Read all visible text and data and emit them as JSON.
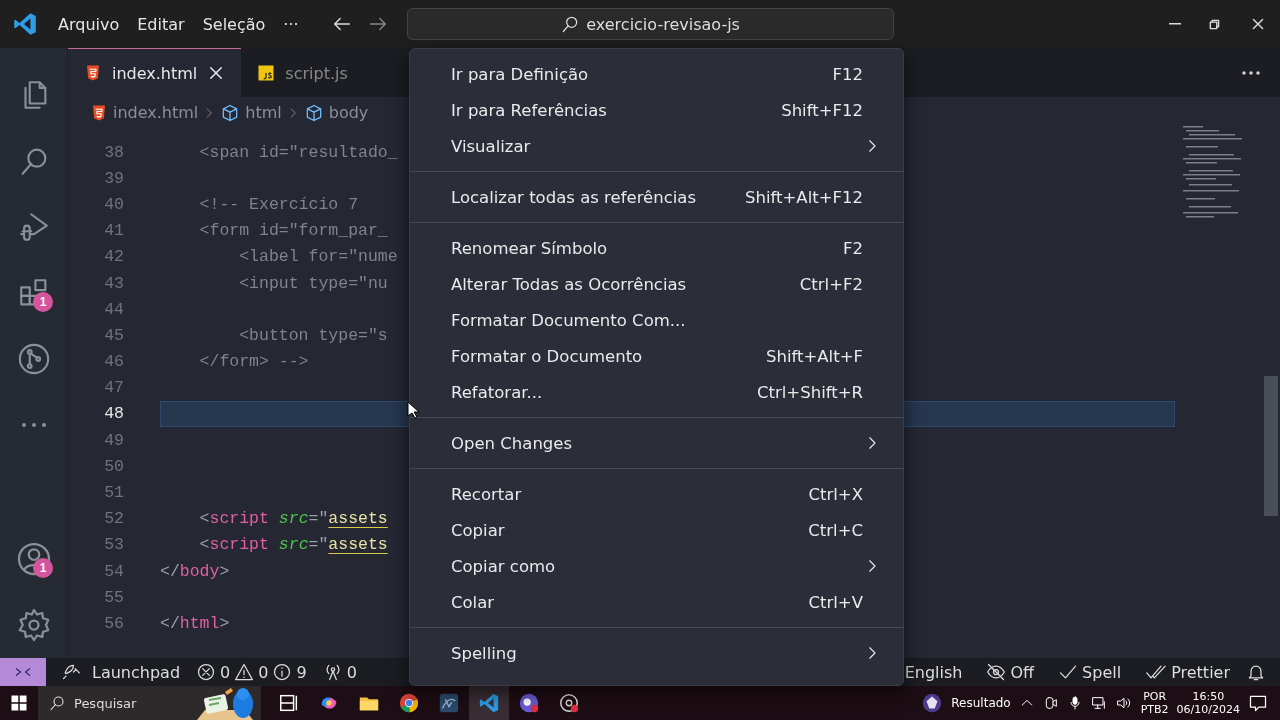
{
  "title_bar": {
    "menus": [
      "Arquivo",
      "Editar",
      "Seleção"
    ],
    "more": "···",
    "search": "exercicio-revisao-js"
  },
  "activity_bar": {
    "top": [
      {
        "kind": "files"
      },
      {
        "kind": "search"
      },
      {
        "kind": "run"
      },
      {
        "kind": "extensions",
        "badge": "1"
      },
      {
        "kind": "source-control"
      },
      {
        "kind": "more"
      }
    ],
    "bottom": [
      {
        "kind": "account",
        "badge": "1"
      },
      {
        "kind": "settings"
      }
    ]
  },
  "tabs": [
    {
      "label": "index.html",
      "kind": "html",
      "selected": true
    },
    {
      "label": "script.js",
      "kind": "js",
      "selected": false
    }
  ],
  "breadcrumb": [
    {
      "label": "index.html",
      "kind": "html"
    },
    {
      "label": "html",
      "kind": "element"
    },
    {
      "label": "body",
      "kind": "element"
    }
  ],
  "editor": {
    "lines": [
      {
        "number": "38",
        "current": false,
        "tokens": [
          {
            "kind": "dim",
            "text": "    <span id=\"resultado_"
          }
        ]
      },
      {
        "number": "39",
        "current": false
      },
      {
        "number": "40",
        "current": false,
        "tokens": [
          {
            "kind": "dim",
            "text": "    <!-- Exercício 7"
          }
        ]
      },
      {
        "number": "41",
        "current": false,
        "tokens": [
          {
            "kind": "dim",
            "text": "    <form id=\"form_par_"
          }
        ]
      },
      {
        "number": "42",
        "current": false,
        "tokens": [
          {
            "kind": "dim",
            "text": "        <label for=\"nume"
          }
        ]
      },
      {
        "number": "43",
        "current": false,
        "tokens": [
          {
            "kind": "dim",
            "text": "        <input type=\"nu"
          }
        ]
      },
      {
        "number": "44",
        "current": false
      },
      {
        "number": "45",
        "current": false,
        "tokens": [
          {
            "kind": "dim",
            "text": "        <button type=\"s"
          }
        ]
      },
      {
        "number": "46",
        "current": false,
        "tokens": [
          {
            "kind": "dim",
            "text": "    </form> -->"
          }
        ]
      },
      {
        "number": "47",
        "current": false
      },
      {
        "number": "48",
        "current": true
      },
      {
        "number": "49",
        "current": false
      },
      {
        "number": "50",
        "current": false
      },
      {
        "number": "51",
        "current": false
      },
      {
        "number": "52",
        "current": false,
        "tokens": [
          {
            "kind": "punct",
            "text": "    <"
          },
          {
            "kind": "tag",
            "text": "script"
          },
          {
            "kind": "attr",
            "text": " src"
          },
          {
            "kind": "punct",
            "text": "=\""
          },
          {
            "kind": "string",
            "text": "assets"
          }
        ]
      },
      {
        "number": "53",
        "current": false,
        "tokens": [
          {
            "kind": "punct",
            "text": "    <"
          },
          {
            "kind": "tag",
            "text": "script"
          },
          {
            "kind": "attr",
            "text": " src"
          },
          {
            "kind": "punct",
            "text": "=\""
          },
          {
            "kind": "string",
            "text": "assets"
          }
        ]
      },
      {
        "number": "54",
        "current": false,
        "tokens": [
          {
            "kind": "punct",
            "text": "</"
          },
          {
            "kind": "tag",
            "text": "body"
          },
          {
            "kind": "punct",
            "text": ">"
          }
        ]
      },
      {
        "number": "55",
        "current": false
      },
      {
        "number": "56",
        "current": false,
        "tokens": [
          {
            "kind": "punct",
            "text": "</"
          },
          {
            "kind": "tag",
            "text": "html"
          },
          {
            "kind": "punct",
            "text": ">"
          }
        ]
      }
    ]
  },
  "context_menu": {
    "groups": [
      [
        {
          "label": "Ir para Definição",
          "shortcut": "F12",
          "submenu": false
        },
        {
          "label": "Ir para Referências",
          "shortcut": "Shift+F12",
          "submenu": false
        },
        {
          "label": "Visualizar",
          "submenu": true
        }
      ],
      [
        {
          "label": "Localizar todas as referências",
          "shortcut": "Shift+Alt+F12",
          "submenu": false
        }
      ],
      [
        {
          "label": "Renomear Símbolo",
          "shortcut": "F2",
          "submenu": false
        },
        {
          "label": "Alterar Todas as Ocorrências",
          "shortcut": "Ctrl+F2",
          "submenu": false
        },
        {
          "label": "Formatar Documento Com...",
          "submenu": false
        },
        {
          "label": "Formatar o Documento",
          "shortcut": "Shift+Alt+F",
          "submenu": false
        },
        {
          "label": "Refatorar...",
          "shortcut": "Ctrl+Shift+R",
          "submenu": false
        }
      ],
      [
        {
          "label": "Open Changes",
          "submenu": true
        }
      ],
      [
        {
          "label": "Recortar",
          "shortcut": "Ctrl+X",
          "submenu": false
        },
        {
          "label": "Copiar",
          "shortcut": "Ctrl+C",
          "submenu": false
        },
        {
          "label": "Copiar como",
          "submenu": true
        },
        {
          "label": "Colar",
          "shortcut": "Ctrl+V",
          "submenu": false
        }
      ],
      [
        {
          "label": "Spelling",
          "submenu": true
        }
      ]
    ]
  },
  "status_bar": {
    "launchpad": "Launchpad",
    "errors": "0",
    "warnings": "0",
    "infos": "9",
    "ports": "0",
    "right": [
      {
        "kind": "text",
        "label": "English"
      },
      {
        "kind": "eye-off",
        "label": "Off"
      },
      {
        "kind": "check",
        "label": "Spell"
      },
      {
        "kind": "double-check",
        "label": "Prettier"
      },
      {
        "kind": "bell"
      }
    ]
  },
  "taskbar": {
    "search": "Pesquisar",
    "apps": [
      {
        "kind": "task-view",
        "selected": false
      },
      {
        "kind": "swirl",
        "selected": false
      },
      {
        "kind": "folder",
        "selected": false
      },
      {
        "kind": "browser",
        "selected": false
      },
      {
        "kind": "database",
        "selected": false
      },
      {
        "kind": "editor",
        "selected": true
      },
      {
        "kind": "chat",
        "selected": false
      },
      {
        "kind": "recorder",
        "selected": false
      }
    ],
    "weather": "Resultado",
    "lang": "POR",
    "layout": "PTB2",
    "time": "16:50",
    "date": "06/10/2024"
  }
}
